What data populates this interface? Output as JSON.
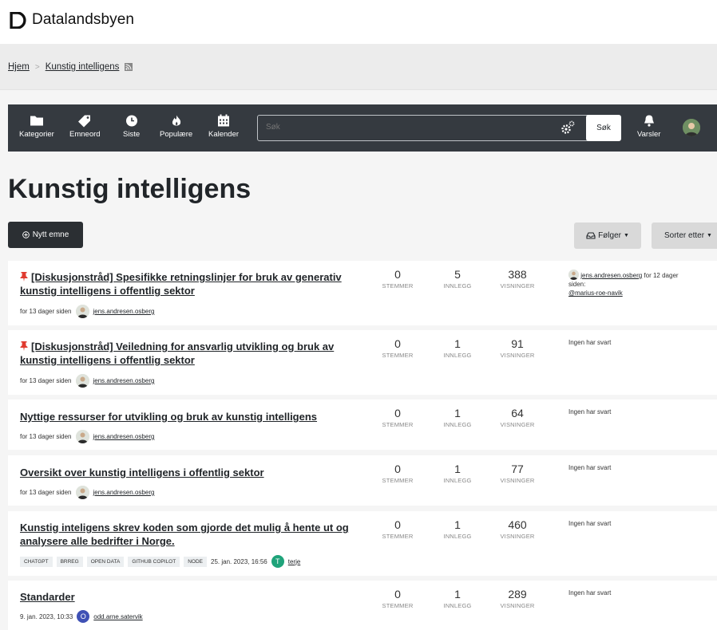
{
  "brand": {
    "name": "Datalandsbyen"
  },
  "breadcrumb": {
    "home": "Hjem",
    "separator": ">",
    "current": "Kunstig intelligens"
  },
  "nav": {
    "items": [
      {
        "label": "Kategorier",
        "icon": "folder-icon"
      },
      {
        "label": "Emneord",
        "icon": "tag-icon"
      },
      {
        "label": "Siste",
        "icon": "clock-icon"
      },
      {
        "label": "Populære",
        "icon": "fire-icon"
      },
      {
        "label": "Kalender",
        "icon": "calendar-icon"
      }
    ],
    "search_placeholder": "Søk",
    "search_button": "Søk",
    "notifications": "Varsler"
  },
  "page": {
    "title": "Kunstig intelligens"
  },
  "toolbar": {
    "new_topic": "Nytt emne",
    "follow": "Følger",
    "sort": "Sorter etter"
  },
  "labels": {
    "votes": "STEMMER",
    "posts": "INNLEGG",
    "views": "VISNINGER",
    "no_reply": "Ingen har svart"
  },
  "topics": [
    {
      "pinned": true,
      "title_line1": "[Diskusjonstråd] Spesifikke retningslinjer for bruk av generativ",
      "title_line2": "kunstig intelligens i offentlig sektor",
      "time": "for 13 dager siden",
      "author": "jens.andresen.osberg",
      "votes": "0",
      "posts": "5",
      "views": "388",
      "last_user": "jens.andresen.osberg",
      "last_time": "for 12 dager",
      "last_time2": "siden:",
      "last_mention": "@marius-roe-navik"
    },
    {
      "pinned": true,
      "title_line1": "[Diskusjonstråd] Veiledning for ansvarlig utvikling og bruk av",
      "title_line2": "kunstig intelligens i offentlig sektor",
      "time": "for 13 dager siden",
      "author": "jens.andresen.osberg",
      "votes": "0",
      "posts": "1",
      "views": "91"
    },
    {
      "title_line1": "Nyttige ressurser for utvikling og bruk av kunstig intelligens",
      "time": "for 13 dager siden",
      "author": "jens.andresen.osberg",
      "votes": "0",
      "posts": "1",
      "views": "64"
    },
    {
      "title_line1": "Oversikt over kunstig intelligens i offentlig sektor",
      "time": "for 13 dager siden",
      "author": "jens.andresen.osberg",
      "votes": "0",
      "posts": "1",
      "views": "77"
    },
    {
      "title_line1": "Kunstig inteligens skrev koden som gjorde det mulig å hente ut og",
      "title_line2": "analysere alle bedrifter i Norge.",
      "tags": [
        "CHATGPT",
        "BRREG",
        "OPEN DATA",
        "GITHUB COPILOT",
        "NODE"
      ],
      "time": "25. jan. 2023, 16:56",
      "author": "terje",
      "author_initial": "T",
      "avatar_color": "#1fa37a",
      "votes": "0",
      "posts": "1",
      "views": "460"
    },
    {
      "title_line1": "Standarder",
      "time": "9. jan. 2023, 10:33",
      "author": "odd.arne.satervik",
      "author_initial": "O",
      "avatar_color": "#3f51b5",
      "votes": "0",
      "posts": "1",
      "views": "289"
    }
  ]
}
